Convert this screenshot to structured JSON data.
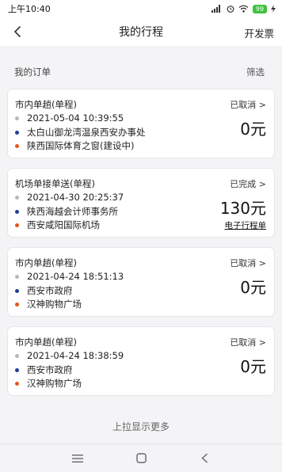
{
  "status_bar": {
    "time": "上午10:40",
    "battery": "99"
  },
  "header": {
    "title": "我的行程",
    "invoice_label": "开发票"
  },
  "section": {
    "title": "我的订单",
    "filter_label": "筛选"
  },
  "orders": [
    {
      "type": "市内单趟(单程)",
      "status": "已取消 >",
      "time": "2021-05-04 10:39:55",
      "start": "太白山御龙湾温泉西安办事处",
      "end": "陕西国际体育之窗(建设中)",
      "price": "0元"
    },
    {
      "type": "机场单接单送(单程)",
      "status": "已完成 >",
      "time": "2021-04-30 20:25:37",
      "start": "陕西海越会计师事务所",
      "end": "西安咸阳国际机场",
      "price": "130元",
      "link": "电子行程单"
    },
    {
      "type": "市内单趟(单程)",
      "status": "已取消 >",
      "time": "2021-04-24 18:51:13",
      "start": "西安市政府",
      "end": "汉神购物广场",
      "price": "0元"
    },
    {
      "type": "市内单趟(单程)",
      "status": "已取消 >",
      "time": "2021-04-24 18:38:59",
      "start": "西安市政府",
      "end": "汉神购物广场",
      "price": "0元"
    }
  ],
  "footer": {
    "load_more": "上拉显示更多"
  },
  "colors": {
    "start_dot": "#1f3f8f",
    "end_dot": "#e0581e",
    "time_dot": "#b8b8b8",
    "battery": "#3fc23f"
  },
  "icons": [
    "back-arrow-icon",
    "menu-icon",
    "home-square-icon",
    "back-triangle-icon",
    "signal-icon",
    "wifi-icon",
    "alarm-icon",
    "battery-icon",
    "charging-icon"
  ]
}
